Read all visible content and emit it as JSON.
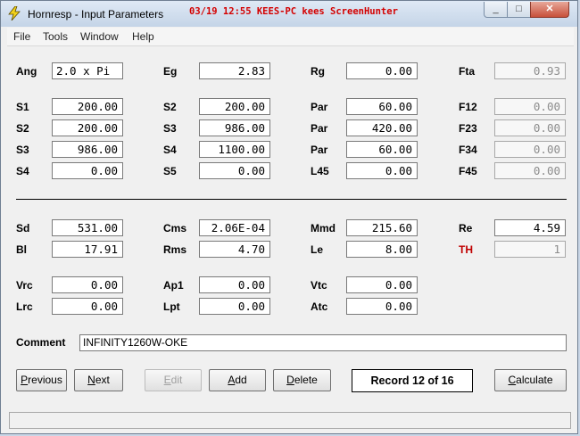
{
  "window": {
    "title": "Hornresp - Input Parameters",
    "stamp": "03/19 12:55 KEES-PC kees ScreenHunter",
    "min_glyph": "_",
    "max_glyph": "□",
    "close_glyph": "✕"
  },
  "menu": [
    "File",
    "Tools",
    "Window",
    "Help"
  ],
  "labels": {
    "ang": "Ang",
    "eg": "Eg",
    "rg": "Rg",
    "fta": "Fta",
    "s1": "S1",
    "s2a": "S2",
    "par1": "Par",
    "f12": "F12",
    "s2b": "S2",
    "s3a": "S3",
    "par2": "Par",
    "f23": "F23",
    "s3b": "S3",
    "s4a": "S4",
    "par3": "Par",
    "f34": "F34",
    "s4b": "S4",
    "s5": "S5",
    "l45": "L45",
    "f45": "F45",
    "sd": "Sd",
    "cms": "Cms",
    "mmd": "Mmd",
    "re": "Re",
    "bl": "Bl",
    "rms": "Rms",
    "le": "Le",
    "th": "TH",
    "vrc": "Vrc",
    "ap1": "Ap1",
    "vtc": "Vtc",
    "lrc": "Lrc",
    "lpt": "Lpt",
    "atc": "Atc",
    "comment": "Comment"
  },
  "values": {
    "ang": "2.0 x Pi",
    "eg": "2.83",
    "rg": "0.00",
    "fta": "0.93",
    "s1": "200.00",
    "s2a": "200.00",
    "par1": "60.00",
    "f12": "0.00",
    "s2b": "200.00",
    "s3a": "986.00",
    "par2": "420.00",
    "f23": "0.00",
    "s3b": "986.00",
    "s4a": "1100.00",
    "par3": "60.00",
    "f34": "0.00",
    "s4b": "0.00",
    "s5": "0.00",
    "l45": "0.00",
    "f45": "0.00",
    "sd": "531.00",
    "cms": "2.06E-04",
    "mmd": "215.60",
    "re": "4.59",
    "bl": "17.91",
    "rms": "4.70",
    "le": "8.00",
    "th": "1",
    "vrc": "0.00",
    "ap1": "0.00",
    "vtc": "0.00",
    "lrc": "0.00",
    "lpt": "0.00",
    "atc": "0.00",
    "comment": "INFINITY1260W-OKE"
  },
  "buttons": {
    "previous_first": "P",
    "previous_rest": "revious",
    "next_first": "N",
    "next_rest": "ext",
    "edit_first": "E",
    "edit_rest": "dit",
    "add_first": "A",
    "add_rest": "dd",
    "delete_first": "D",
    "delete_rest": "elete",
    "calculate_first": "C",
    "calculate_rest": "alculate"
  },
  "record": "Record 12 of 16",
  "colors": {
    "stamp": "#d40000",
    "th_label": "#c00000"
  }
}
